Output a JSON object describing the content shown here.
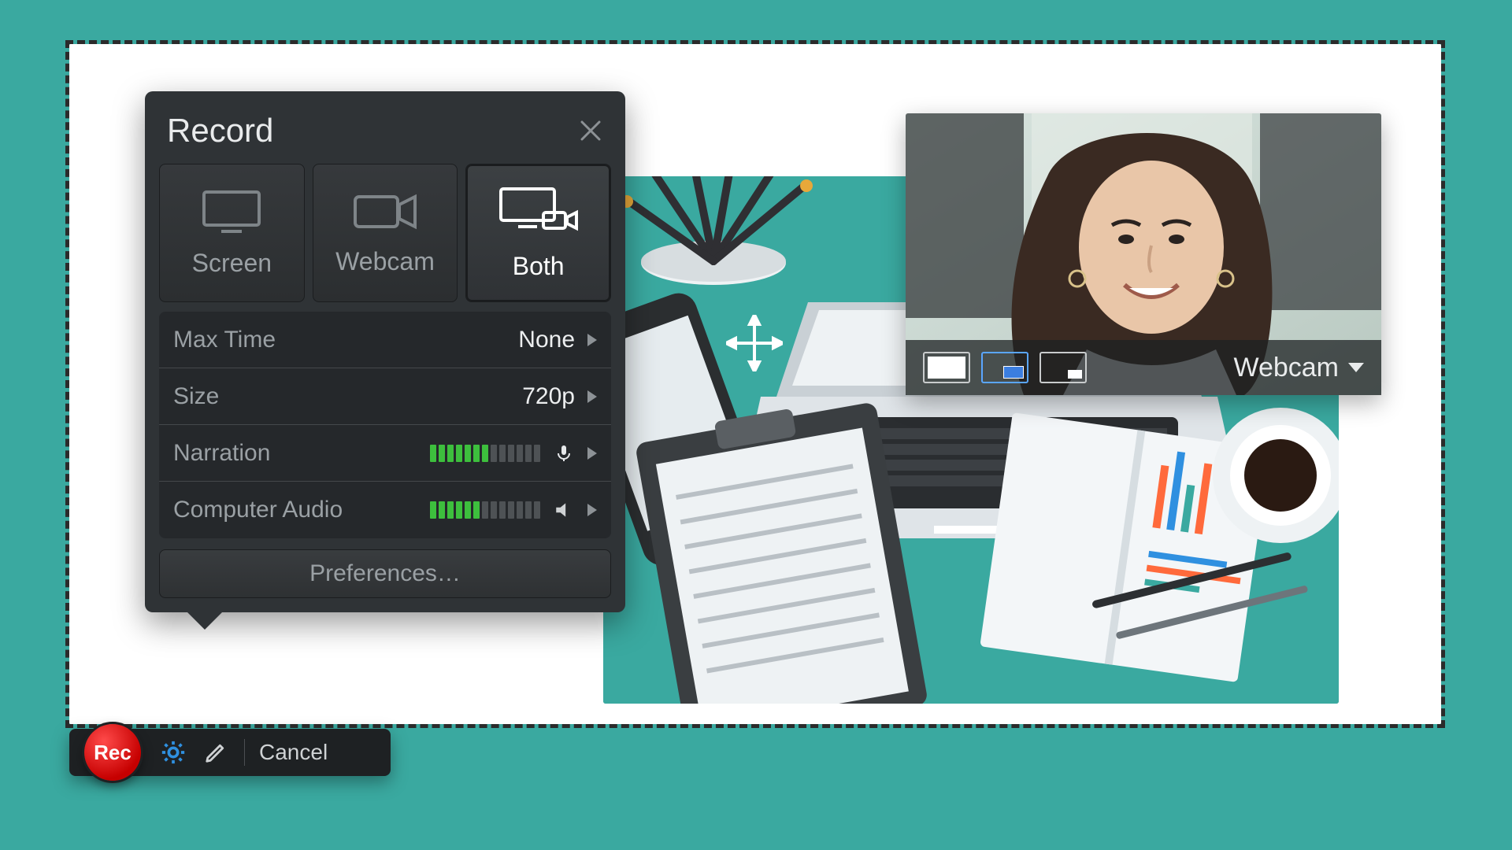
{
  "record_panel": {
    "title": "Record",
    "modes": [
      {
        "label": "Screen",
        "active": false
      },
      {
        "label": "Webcam",
        "active": false
      },
      {
        "label": "Both",
        "active": true
      }
    ],
    "settings": {
      "max_time": {
        "label": "Max Time",
        "value": "None"
      },
      "size": {
        "label": "Size",
        "value": "720p"
      },
      "narration": {
        "label": "Narration",
        "vu_on_bars": 7,
        "vu_total_bars": 13
      },
      "computer_audio": {
        "label": "Computer Audio",
        "vu_on_bars": 6,
        "vu_total_bars": 13
      }
    },
    "preferences_label": "Preferences…"
  },
  "toolbar": {
    "rec_label": "Rec",
    "cancel_label": "Cancel"
  },
  "webcam_overlay": {
    "label": "Webcam",
    "thumbnails": [
      {
        "selected": false
      },
      {
        "selected": true
      },
      {
        "selected": false
      }
    ]
  }
}
